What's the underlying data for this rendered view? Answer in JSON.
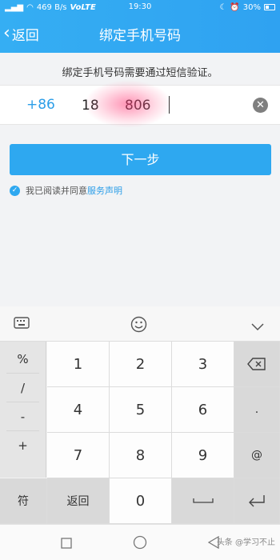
{
  "status_bar": {
    "network": "469 B/s",
    "volte": "VoLTE",
    "time": "19:30",
    "battery": "30%"
  },
  "header": {
    "back_label": "返回",
    "title": "绑定手机号码"
  },
  "instruction": "绑定手机号码需要通过短信验证。",
  "phone": {
    "country_code": "+86",
    "value": "18      806"
  },
  "next_button": "下一步",
  "agreement": {
    "text": "我已阅读并同意",
    "link": "服务声明"
  },
  "keyboard": {
    "symbols": [
      "%",
      "/",
      "-",
      "+"
    ],
    "digits": [
      "1",
      "2",
      "3",
      "4",
      "5",
      "6",
      "7",
      "8",
      "9",
      "0"
    ],
    "dot": ".",
    "at": "@",
    "fu": "符",
    "back": "返回"
  },
  "watermark": "头条 @学习不止"
}
